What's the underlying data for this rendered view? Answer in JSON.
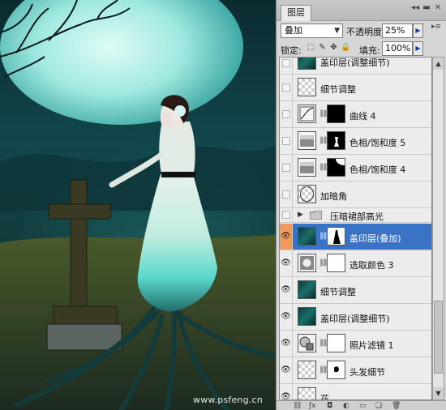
{
  "canvas": {
    "watermark": "www.psfeng.cn"
  },
  "panel": {
    "tab_label": "图层",
    "controls": [
      "◂◂",
      "▬",
      "✕"
    ],
    "menu_icon": "▸≡",
    "blend_mode": "叠加",
    "opacity_label": "不透明度:",
    "opacity_value": "25%",
    "lock_label": "锁定:",
    "fill_label": "填充:",
    "fill_value": "100%"
  },
  "layers": [
    {
      "name": "盖印层(调整细节)",
      "visible": false,
      "kind": "photo"
    },
    {
      "name": "细节调整",
      "visible": false,
      "kind": "checker"
    },
    {
      "name": "曲线 4",
      "visible": false,
      "kind": "curves",
      "mask": "black"
    },
    {
      "name": "色相/饱和度 5",
      "visible": false,
      "kind": "huesat",
      "mask": "black-figure"
    },
    {
      "name": "色相/饱和度 4",
      "visible": false,
      "kind": "huesat",
      "mask": "white-corner"
    },
    {
      "name": "加暗角",
      "visible": false,
      "kind": "checker-oval"
    },
    {
      "name": "压暗裙部高光",
      "visible": false,
      "kind": "group"
    },
    {
      "name": "盖印层(叠加)",
      "visible": true,
      "kind": "photo",
      "mask": "white-figure",
      "selected": true
    },
    {
      "name": "选取颜色 3",
      "visible": true,
      "kind": "selectcolor",
      "mask": "white"
    },
    {
      "name": "细节调整",
      "visible": true,
      "kind": "photo"
    },
    {
      "name": "盖印层(调整细节)",
      "visible": true,
      "kind": "photo"
    },
    {
      "name": "照片滤镜 1",
      "visible": true,
      "kind": "photofilter",
      "mask": "white"
    },
    {
      "name": "头发细节",
      "visible": true,
      "kind": "checker",
      "mask": "white-hair"
    },
    {
      "name": "花",
      "visible": true,
      "kind": "checker"
    }
  ],
  "icons": {
    "eye": "eye-icon",
    "link": "link-icon",
    "folder": "folder-icon"
  }
}
